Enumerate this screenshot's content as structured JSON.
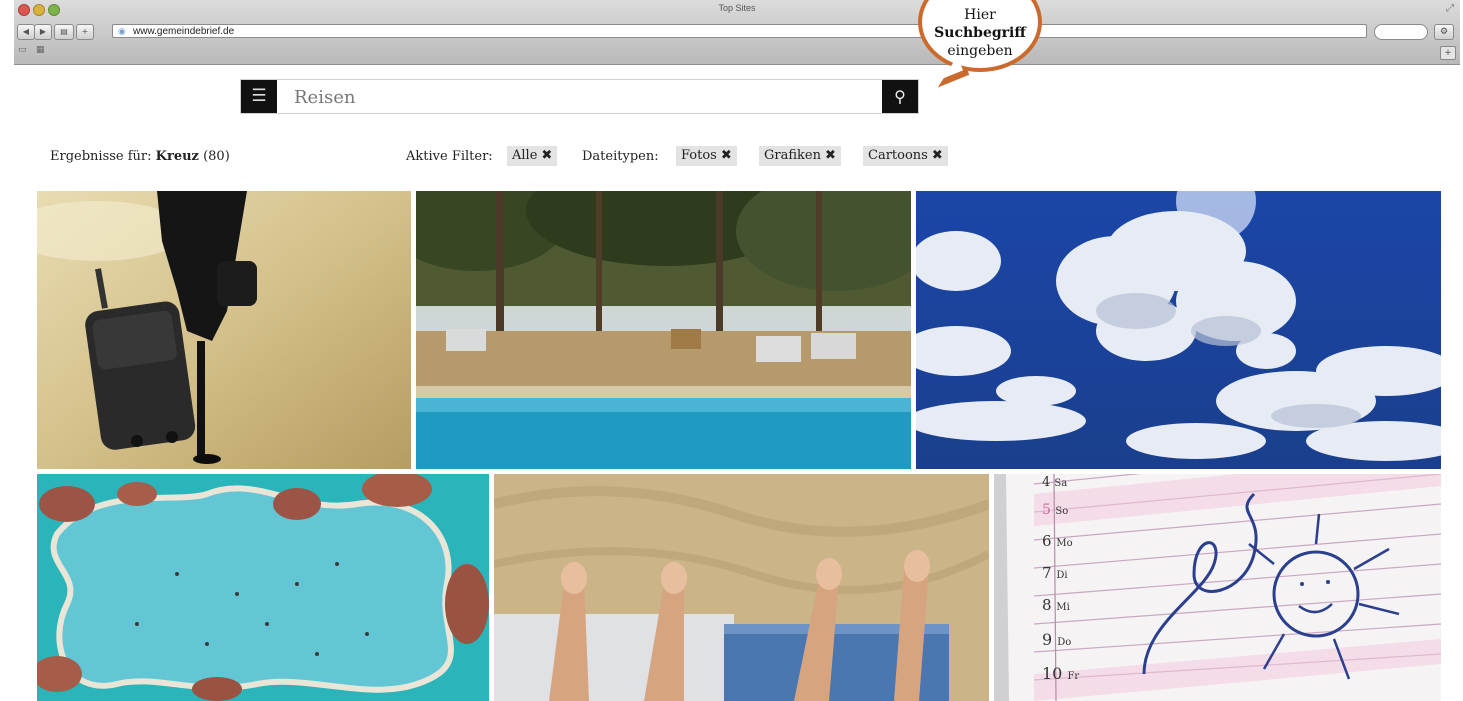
{
  "browser": {
    "window_title": "Top Sites",
    "address": "www.gemeindebrief.de"
  },
  "search": {
    "value": "Reisen"
  },
  "callout": {
    "line1": "Hier",
    "line2": "Suchbegriff",
    "line3": "eingeben"
  },
  "results": {
    "label": "Ergebnisse für:",
    "term": "Kreuz",
    "count": "(80)"
  },
  "filters": {
    "active_label": "Aktive Filter:",
    "active_chip": "Alle",
    "types_label": "Dateitypen:",
    "types": [
      "Fotos",
      "Grafiken",
      "Cartoons"
    ]
  },
  "calendar": {
    "days": [
      {
        "num": "4",
        "day": "Sa"
      },
      {
        "num": "5",
        "day": "So"
      },
      {
        "num": "6",
        "day": "Mo"
      },
      {
        "num": "7",
        "day": "Di"
      },
      {
        "num": "8",
        "day": "Mi"
      },
      {
        "num": "9",
        "day": "Do"
      },
      {
        "num": "10",
        "day": "Fr"
      }
    ]
  },
  "icons": {
    "list": "list-icon",
    "search": "search-icon",
    "close": "close-icon",
    "gear": "gear-icon"
  },
  "colors": {
    "callout_border": "#cb6a2c",
    "chip_bg": "#e3e3e3",
    "button_bg": "#111111"
  }
}
